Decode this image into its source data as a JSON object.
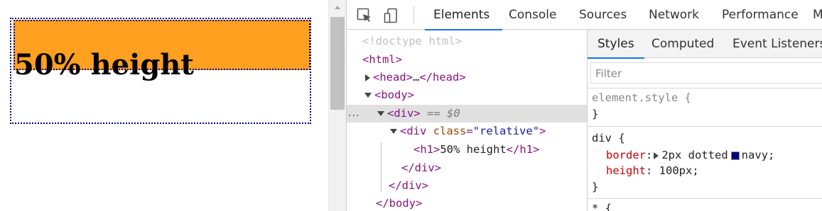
{
  "preview": {
    "heading": "50% height"
  },
  "devtools": {
    "tabs": [
      "Elements",
      "Console",
      "Sources",
      "Network",
      "Performance",
      "M"
    ],
    "active_tab": "Elements",
    "dom_tree": {
      "doctype": "<!doctype html>",
      "html_open": "<html>",
      "head_collapsed_open": "<head>",
      "head_ellipsis": "…",
      "head_close": "</head>",
      "body_open": "<body>",
      "div_open": "<div>",
      "selected_marker": "== $0",
      "inner_div_tag": "div",
      "inner_div_attr_name": "class",
      "inner_div_attr_value": "\"relative\"",
      "h1_open": "<h1>",
      "h1_text": "50% height",
      "h1_close": "</h1>",
      "inner_div_close": "</div>",
      "div_close": "</div>",
      "body_close": "</body>",
      "row_menu": "..."
    },
    "sidebar": {
      "tabs": [
        "Styles",
        "Computed",
        "Event Listeners"
      ],
      "active_tab": "Styles",
      "filter_placeholder": "Filter",
      "element_style": {
        "selector": "element.style {",
        "close": "}"
      },
      "div_rule": {
        "selector": "div {",
        "border_prop": "border",
        "border_value_pre": "2px dotted",
        "border_color_name": "navy;",
        "height_prop": "height",
        "height_value": "100px;",
        "close": "}"
      },
      "next_rule_start": "* {"
    },
    "colors": {
      "swatch": "#000080",
      "preview_fill": "#ffa020",
      "accent": "#1a73e8"
    }
  }
}
